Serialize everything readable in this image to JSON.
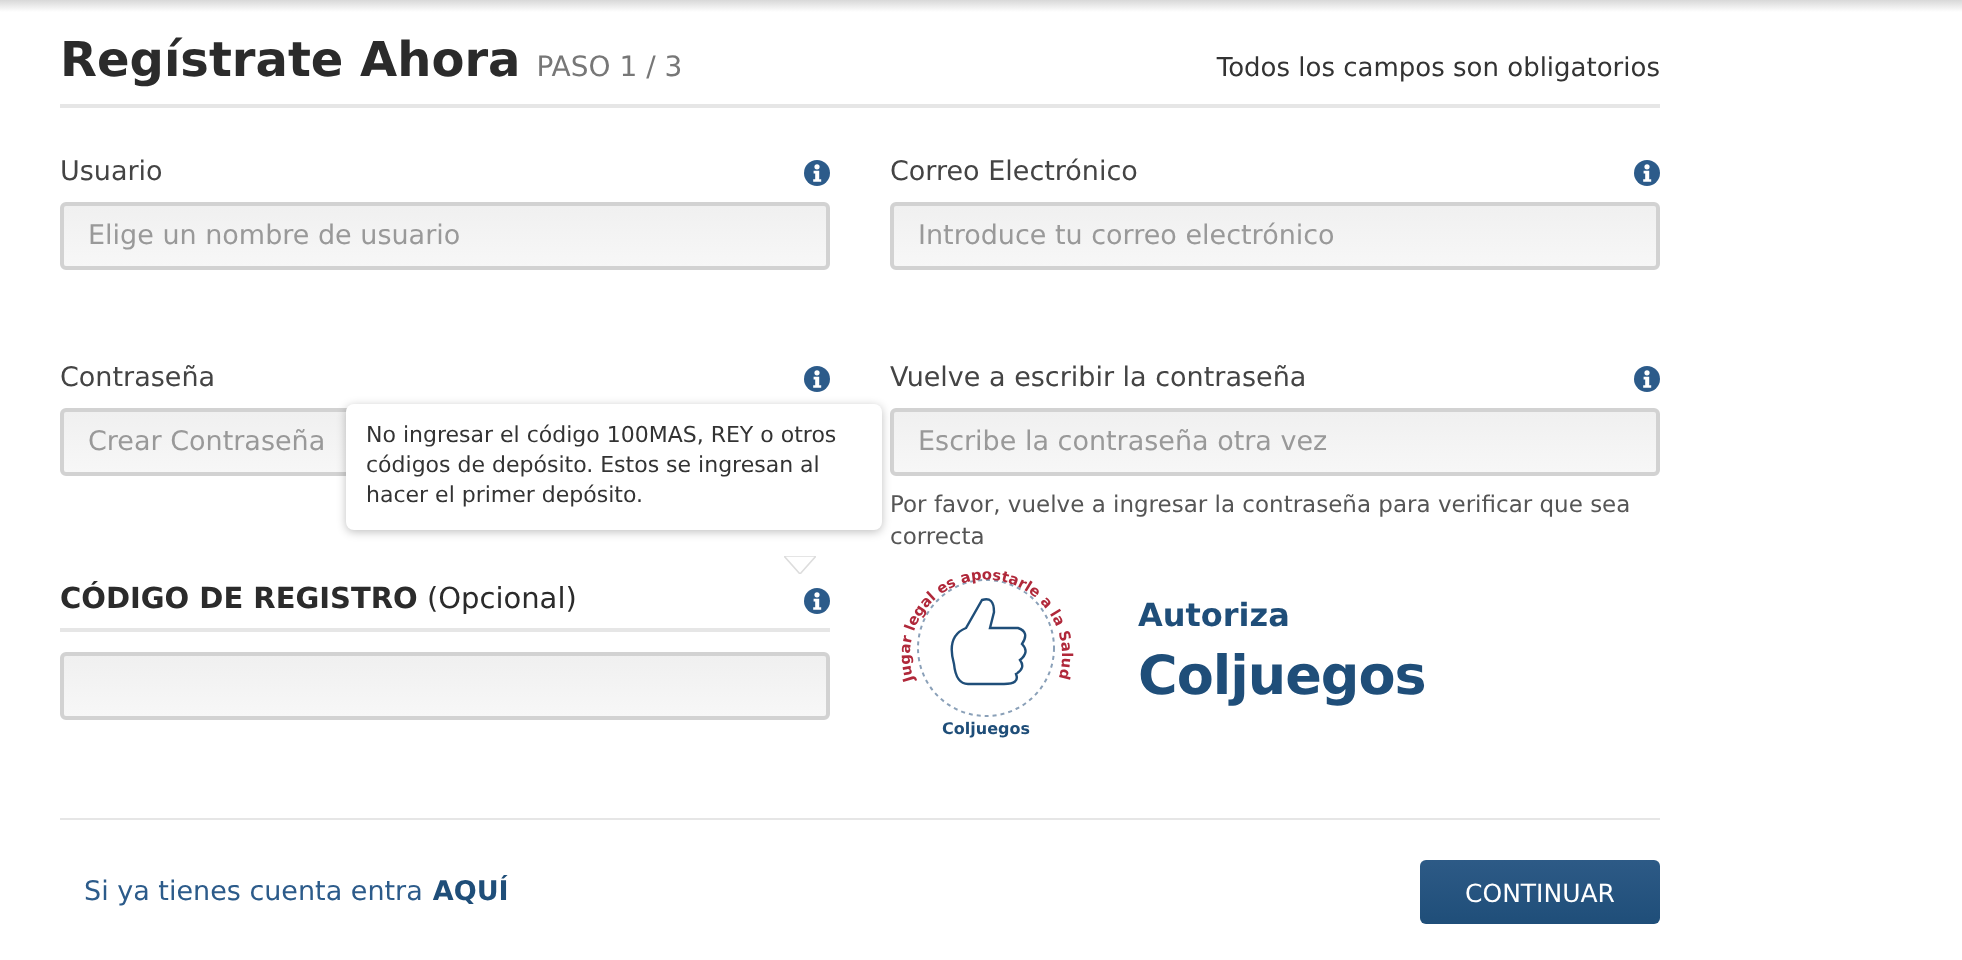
{
  "header": {
    "title": "Regístrate Ahora",
    "step": "PASO 1 / 3",
    "note": "Todos los campos son obligatorios"
  },
  "fields": [
    {
      "label": "Usuario",
      "placeholder": "Elige un nombre de usuario"
    },
    {
      "label": "Correo Electrónico",
      "placeholder": "Introduce tu correo electrónico"
    },
    {
      "label": "Contraseña",
      "placeholder": "Crear Contraseña"
    },
    {
      "label": "Vuelve a escribir la contraseña",
      "placeholder": "Escribe la contraseña otra vez",
      "hint": "Por favor, vuelve a ingresar la contraseña para verificar que sea correcta"
    }
  ],
  "registration_code": {
    "title": "CÓDIGO DE REGISTRO",
    "suffix": "(Opcional)"
  },
  "tooltip": {
    "text": "No ingresar el código 100MAS, REY o otros códigos de depósito. Estos se ingresan al hacer el primer depósito."
  },
  "authorization": {
    "seal_text": "Jugar legal es apostarle a la Salud",
    "seal_brand": "Coljuegos",
    "label": "Autoriza",
    "brand": "Coljuegos"
  },
  "footer": {
    "login_text": "Si ya tienes cuenta entra",
    "login_link": "AQUÍ",
    "button": "CONTINUAR"
  }
}
